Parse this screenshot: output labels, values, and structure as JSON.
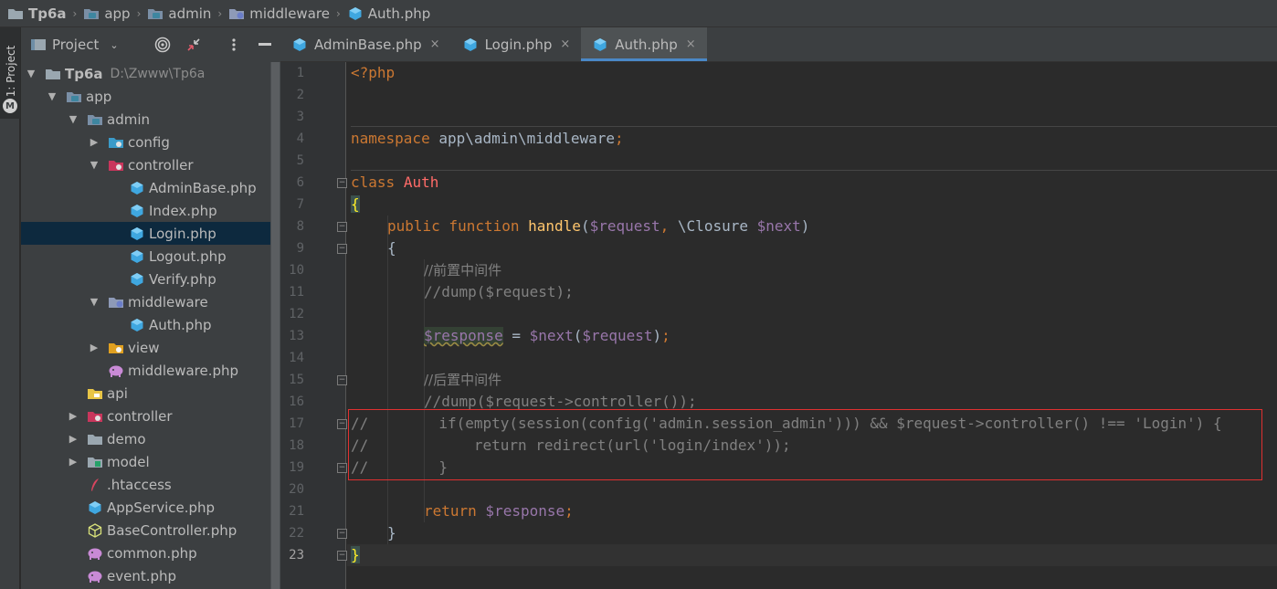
{
  "breadcrumb": {
    "items": [
      {
        "label": "Tp6a",
        "icon": "folder-icon"
      },
      {
        "label": "app",
        "icon": "module-folder-icon"
      },
      {
        "label": "admin",
        "icon": "module-folder-icon"
      },
      {
        "label": "middleware",
        "icon": "middleware-folder-icon"
      },
      {
        "label": "Auth.php",
        "icon": "php-file-icon"
      }
    ]
  },
  "sidebar_stripe": {
    "label": "1: Project"
  },
  "project_panel": {
    "title": "Project",
    "tree": [
      {
        "label": "Tp6a",
        "path": "D:\\Zwww\\Tp6a",
        "icon": "folder-icon",
        "expanded": true
      },
      {
        "label": "app",
        "icon": "module-folder-icon",
        "expanded": true
      },
      {
        "label": "admin",
        "icon": "module-folder-icon",
        "expanded": true
      },
      {
        "label": "config",
        "icon": "config-folder-icon",
        "expanded": false
      },
      {
        "label": "controller",
        "icon": "controller-folder-icon",
        "expanded": true
      },
      {
        "label": "AdminBase.php",
        "icon": "php-file-icon"
      },
      {
        "label": "Index.php",
        "icon": "php-file-icon"
      },
      {
        "label": "Login.php",
        "icon": "php-file-icon",
        "selected": true
      },
      {
        "label": "Logout.php",
        "icon": "php-file-icon"
      },
      {
        "label": "Verify.php",
        "icon": "php-file-icon"
      },
      {
        "label": "middleware",
        "icon": "middleware-folder-icon",
        "expanded": true
      },
      {
        "label": "Auth.php",
        "icon": "php-file-icon"
      },
      {
        "label": "view",
        "icon": "view-folder-icon",
        "expanded": false
      },
      {
        "label": "middleware.php",
        "icon": "elephant-icon"
      },
      {
        "label": "api",
        "icon": "api-folder-icon"
      },
      {
        "label": "controller",
        "icon": "controller-folder-icon",
        "expanded": false
      },
      {
        "label": "demo",
        "icon": "folder-icon",
        "expanded": false
      },
      {
        "label": "model",
        "icon": "model-folder-icon",
        "expanded": false
      },
      {
        "label": ".htaccess",
        "icon": "feather-icon"
      },
      {
        "label": "AppService.php",
        "icon": "php-file-icon"
      },
      {
        "label": "BaseController.php",
        "icon": "php-class-icon"
      },
      {
        "label": "common.php",
        "icon": "elephant-icon"
      },
      {
        "label": "event.php",
        "icon": "elephant-icon"
      }
    ]
  },
  "editor_tabs": [
    {
      "label": "AdminBase.php",
      "close": "×",
      "active": false
    },
    {
      "label": "Login.php",
      "close": "×",
      "active": false
    },
    {
      "label": "Auth.php",
      "close": "×",
      "active": true
    }
  ],
  "editor": {
    "line_numbers": [
      "1",
      "2",
      "3",
      "4",
      "5",
      "6",
      "7",
      "8",
      "9",
      "10",
      "11",
      "12",
      "13",
      "14",
      "15",
      "16",
      "17",
      "18",
      "19",
      "20",
      "21",
      "22",
      "23"
    ],
    "current_line": 23,
    "code": {
      "l1": "<?php",
      "l4_kw": "namespace",
      "l4_rest": " app\\admin\\middleware",
      "l4_semi": ";",
      "l6_kw": "class",
      "l6_name": "Auth",
      "l7": "{",
      "l8_kw": "public function",
      "l8_fn": "handle",
      "l8_p1": "(",
      "l8_v1": "$request",
      "l8_c": ",",
      "l8_cls": " \\Closure ",
      "l8_v2": "$next",
      "l8_p2": ")",
      "l9": "{",
      "l10": "//前置中间件",
      "l11": "//dump($request);",
      "l13_v1": "$response",
      "l13_eq": " = ",
      "l13_v2": "$next",
      "l13_p1": "(",
      "l13_v3": "$request",
      "l13_p2": ")",
      "l13_semi": ";",
      "l15": "//后置中间件",
      "l16": "//dump($request->controller());",
      "l17": "//        if(empty(session(config('admin.session_admin'))) && $request->controller() !== 'Login') {",
      "l18": "//            return redirect(url('login/index'));",
      "l19": "//        }",
      "l21_kw": "return",
      "l21_v": " $response",
      "l21_semi": ";",
      "l22": "}",
      "l23": "}"
    }
  },
  "colors": {
    "keyword": "#cc7832",
    "class_name": "#ff6b68",
    "function": "#ffc66d",
    "variable": "#9876aa",
    "comment": "#808080",
    "highlight_box": "#e03030"
  }
}
